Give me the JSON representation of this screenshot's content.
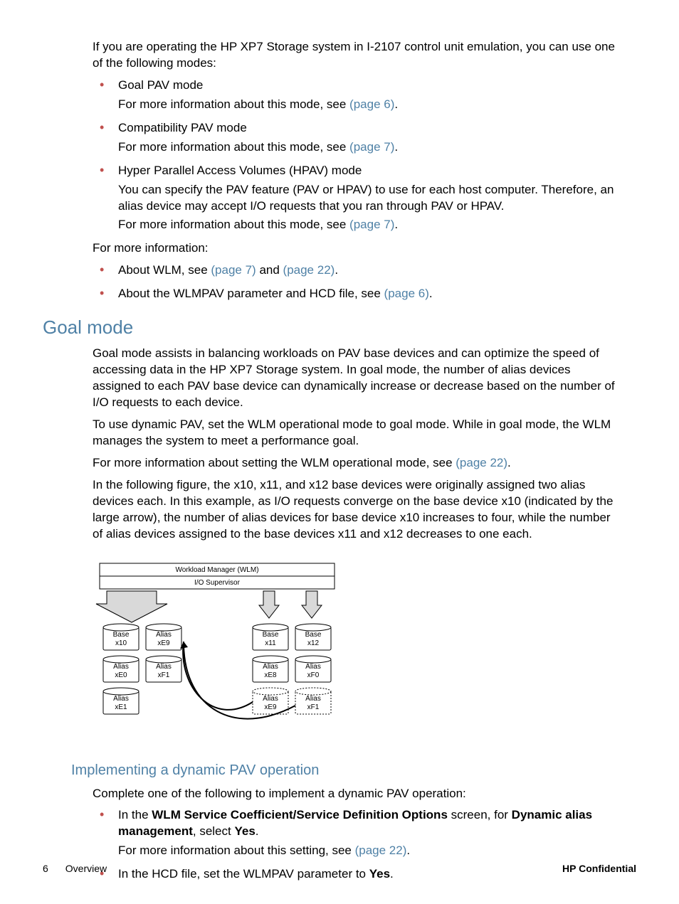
{
  "intro": {
    "p1": "If you are operating the HP XP7 Storage system in I-2107 control unit emulation, you can use one of the following modes:",
    "modes": [
      {
        "title": "Goal PAV mode",
        "desc_prefix": "For more information about this mode, see ",
        "link": "(page 6)",
        "desc_suffix": "."
      },
      {
        "title": "Compatibility PAV mode",
        "desc_prefix": "For more information about this mode, see ",
        "link": "(page 7)",
        "desc_suffix": "."
      },
      {
        "title": "Hyper Parallel Access Volumes (HPAV) mode",
        "extra": "You can specify the PAV feature (PAV or HPAV) to use for each host computer. Therefore, an alias device may accept I/O requests that you ran through PAV or HPAV.",
        "desc_prefix": "For more information about this mode, see ",
        "link": "(page 7)",
        "desc_suffix": "."
      }
    ],
    "more_info_label": "For more information:",
    "more_info_items": [
      {
        "pre": "About WLM, see ",
        "link1": "(page 7)",
        "mid": " and ",
        "link2": "(page 22)",
        "post": "."
      },
      {
        "pre": "About the WLMPAV parameter and HCD file, see ",
        "link1": "(page 6)",
        "mid": "",
        "link2": "",
        "post": "."
      }
    ]
  },
  "goal_mode": {
    "heading": "Goal mode",
    "p1": "Goal mode assists in balancing workloads on PAV base devices and can optimize the speed of accessing data in the HP XP7 Storage system. In goal mode, the number of alias devices assigned to each PAV base device can dynamically increase or decrease based on the number of I/O requests to each device.",
    "p2": "To use dynamic PAV, set the WLM operational mode to goal mode. While in goal mode, the WLM manages the system to meet a performance goal.",
    "p3_pre": "For more information about setting the WLM operational mode, see ",
    "p3_link": "(page 22)",
    "p3_post": ".",
    "p4": "In the following figure, the x10, x11, and x12 base devices were originally assigned two alias devices each. In this example, as I/O requests converge on the base device x10 (indicated by the large arrow), the number of alias devices for base device x10 increases to four, while the number of alias devices assigned to the base devices x11 and x12 decreases to one each."
  },
  "diagram": {
    "wlm_label": "Workload Manager (WLM)",
    "io_label": "I/O Supervisor",
    "left_col1": [
      "Base",
      "x10",
      "Alias",
      "xE0",
      "Alias",
      "xE1"
    ],
    "left_col2": [
      "Alias",
      "xE9",
      "Alias",
      "xF1"
    ],
    "right_col1": [
      "Base",
      "x11",
      "Alias",
      "xE8",
      "Alias",
      "xE9"
    ],
    "right_col2": [
      "Base",
      "x12",
      "Alias",
      "xF0",
      "Alias",
      "xF1"
    ]
  },
  "implementing": {
    "heading": "Implementing a dynamic PAV operation",
    "p1": "Complete one of the following to implement a dynamic PAV operation:",
    "items": [
      {
        "line_parts": [
          "In the ",
          "WLM Service Coefficient/Service Definition Options",
          " screen, for ",
          "Dynamic alias management",
          ", select ",
          "Yes",
          "."
        ],
        "sub_pre": "For more information about this setting, see ",
        "sub_link": "(page 22)",
        "sub_post": "."
      },
      {
        "line_parts": [
          "In the HCD file, set the WLMPAV parameter to ",
          "Yes",
          "."
        ],
        "sub_pre": "",
        "sub_link": "",
        "sub_post": ""
      }
    ]
  },
  "footer": {
    "page_num": "6",
    "section": "Overview",
    "confidential": "HP Confidential"
  }
}
